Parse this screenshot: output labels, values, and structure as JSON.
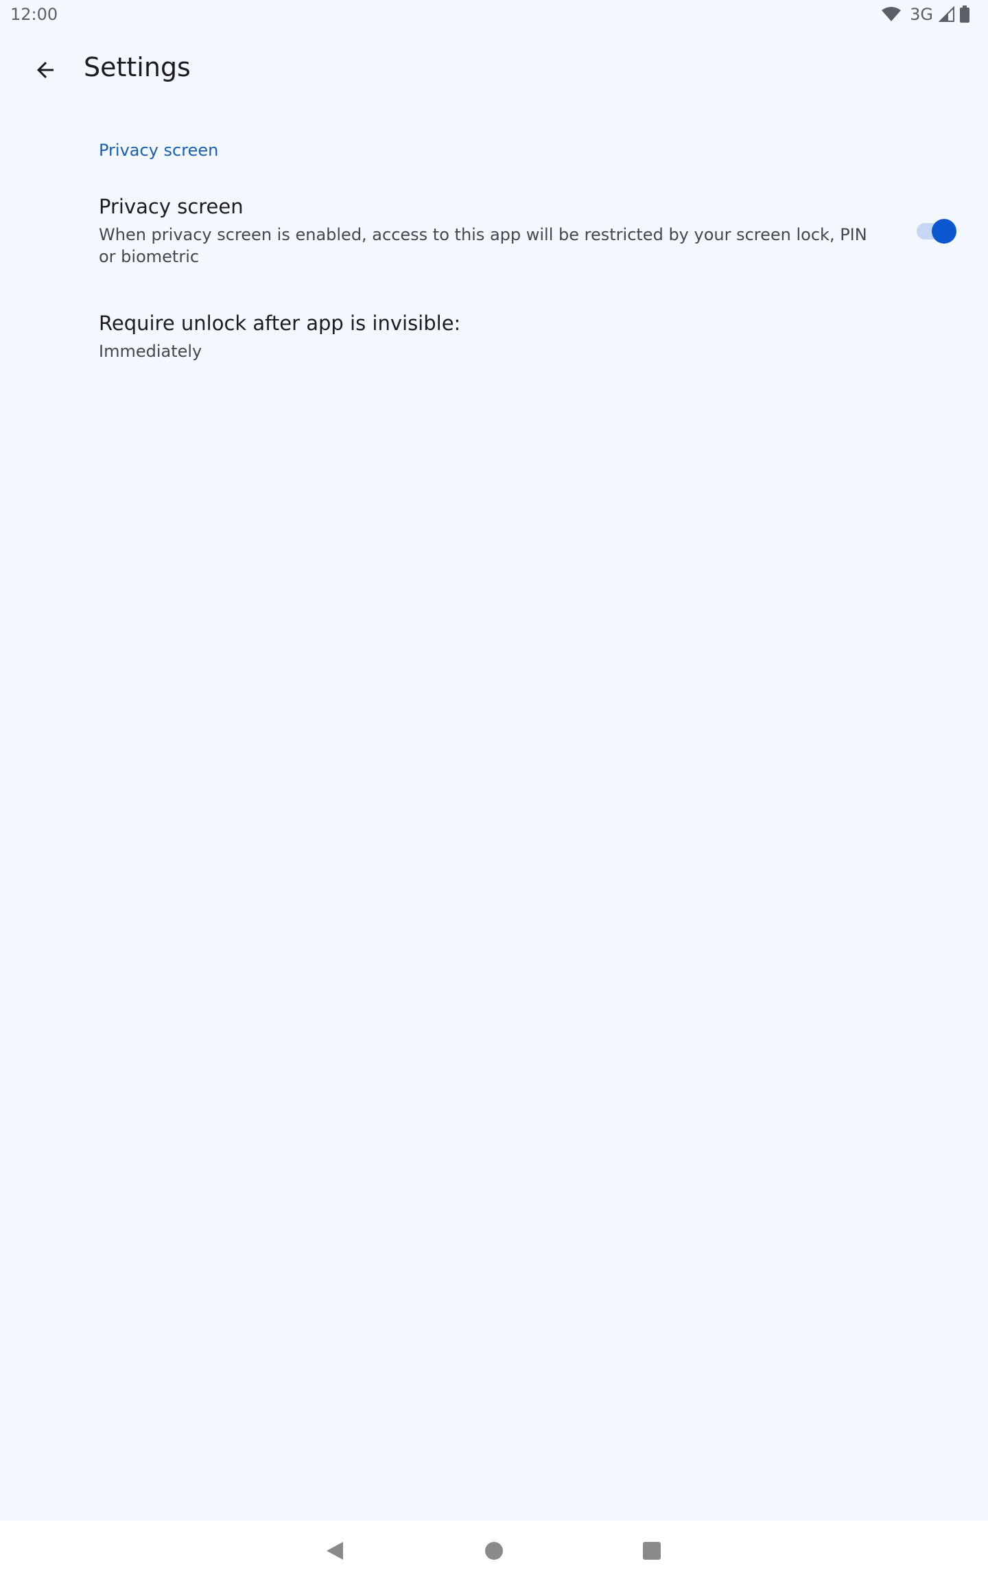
{
  "status_bar": {
    "time": "12:00",
    "network": "3G"
  },
  "top_bar": {
    "title": "Settings"
  },
  "category": {
    "title": "Privacy screen"
  },
  "preferences": [
    {
      "title": "Privacy screen",
      "summary": "When privacy screen is enabled, access to this app will be restricted by your screen lock, PIN or biometric",
      "switch_on": true
    },
    {
      "title": "Require unlock after app is invisible:",
      "summary": "Immediately"
    }
  ],
  "colors": {
    "background": "#f3f7fe",
    "accent": "#0b57d0",
    "category_text": "#1a5fb4",
    "switch_track": "#c6d7f5",
    "nav_bar": "#ffffff"
  }
}
